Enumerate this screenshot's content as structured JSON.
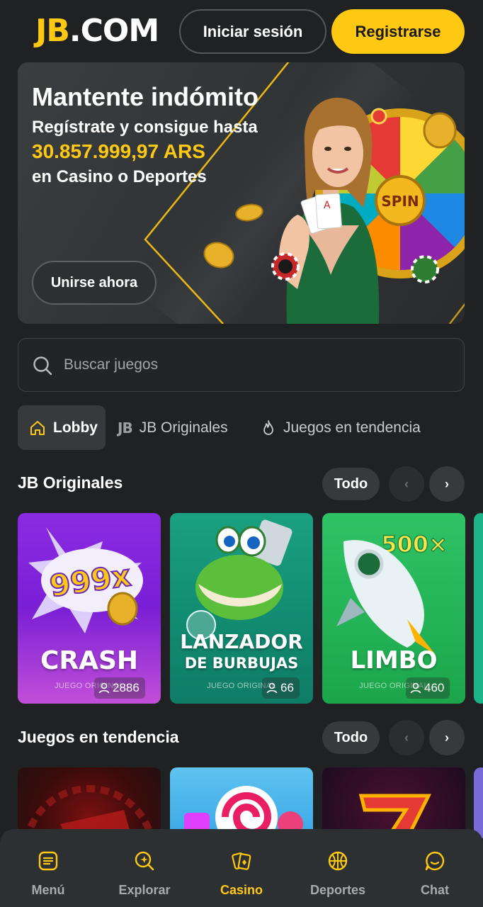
{
  "header": {
    "logo_jb": "JB",
    "logo_com": ".COM",
    "login_label": "Iniciar sesión",
    "register_label": "Registrarse"
  },
  "banner": {
    "title": "Mantente indómito",
    "line1": "Regístrate y consigue hasta",
    "amount": "30.857.999,97 ARS",
    "line2": "en Casino o Deportes",
    "cta": "Unirse ahora",
    "wheel_text": "SPIN"
  },
  "search": {
    "placeholder": "Buscar juegos",
    "value": ""
  },
  "tabs": [
    {
      "label": "Lobby",
      "icon": "home-icon",
      "active": true
    },
    {
      "label": "JB Originales",
      "icon": "jb-logo-icon",
      "active": false
    },
    {
      "label": "Juegos en tendencia",
      "icon": "flame-icon",
      "active": false
    }
  ],
  "originals": {
    "title": "JB Originales",
    "all_label": "Todo",
    "prev": "‹",
    "next": "›",
    "games": [
      {
        "title": "CRASH",
        "badge": "999x",
        "subtitle": "JUEGO ORIGINAL",
        "players": "2886",
        "color": "#8a2be2"
      },
      {
        "title_line1": "LANZADOR",
        "title_line2": "DE BURBUJAS",
        "subtitle": "JUEGO ORIGINAL",
        "players": "66",
        "color": "#118a70"
      },
      {
        "title": "LIMBO",
        "badge": "500×",
        "subtitle": "JUEGO ORIGINAL",
        "players": "460",
        "color": "#23b256"
      }
    ]
  },
  "trending": {
    "title": "Juegos en tendencia",
    "all_label": "Todo",
    "prev": "‹",
    "next": "›"
  },
  "bottom_nav": [
    {
      "label": "Menú",
      "icon": "menu-icon",
      "active": false
    },
    {
      "label": "Explorar",
      "icon": "explore-icon",
      "active": false
    },
    {
      "label": "Casino",
      "icon": "cards-icon",
      "active": true
    },
    {
      "label": "Deportes",
      "icon": "basketball-icon",
      "active": false
    },
    {
      "label": "Chat",
      "icon": "chat-icon",
      "active": false
    }
  ],
  "colors": {
    "accent": "#ffc812",
    "background": "#1f2122",
    "panel": "#2d3032"
  }
}
